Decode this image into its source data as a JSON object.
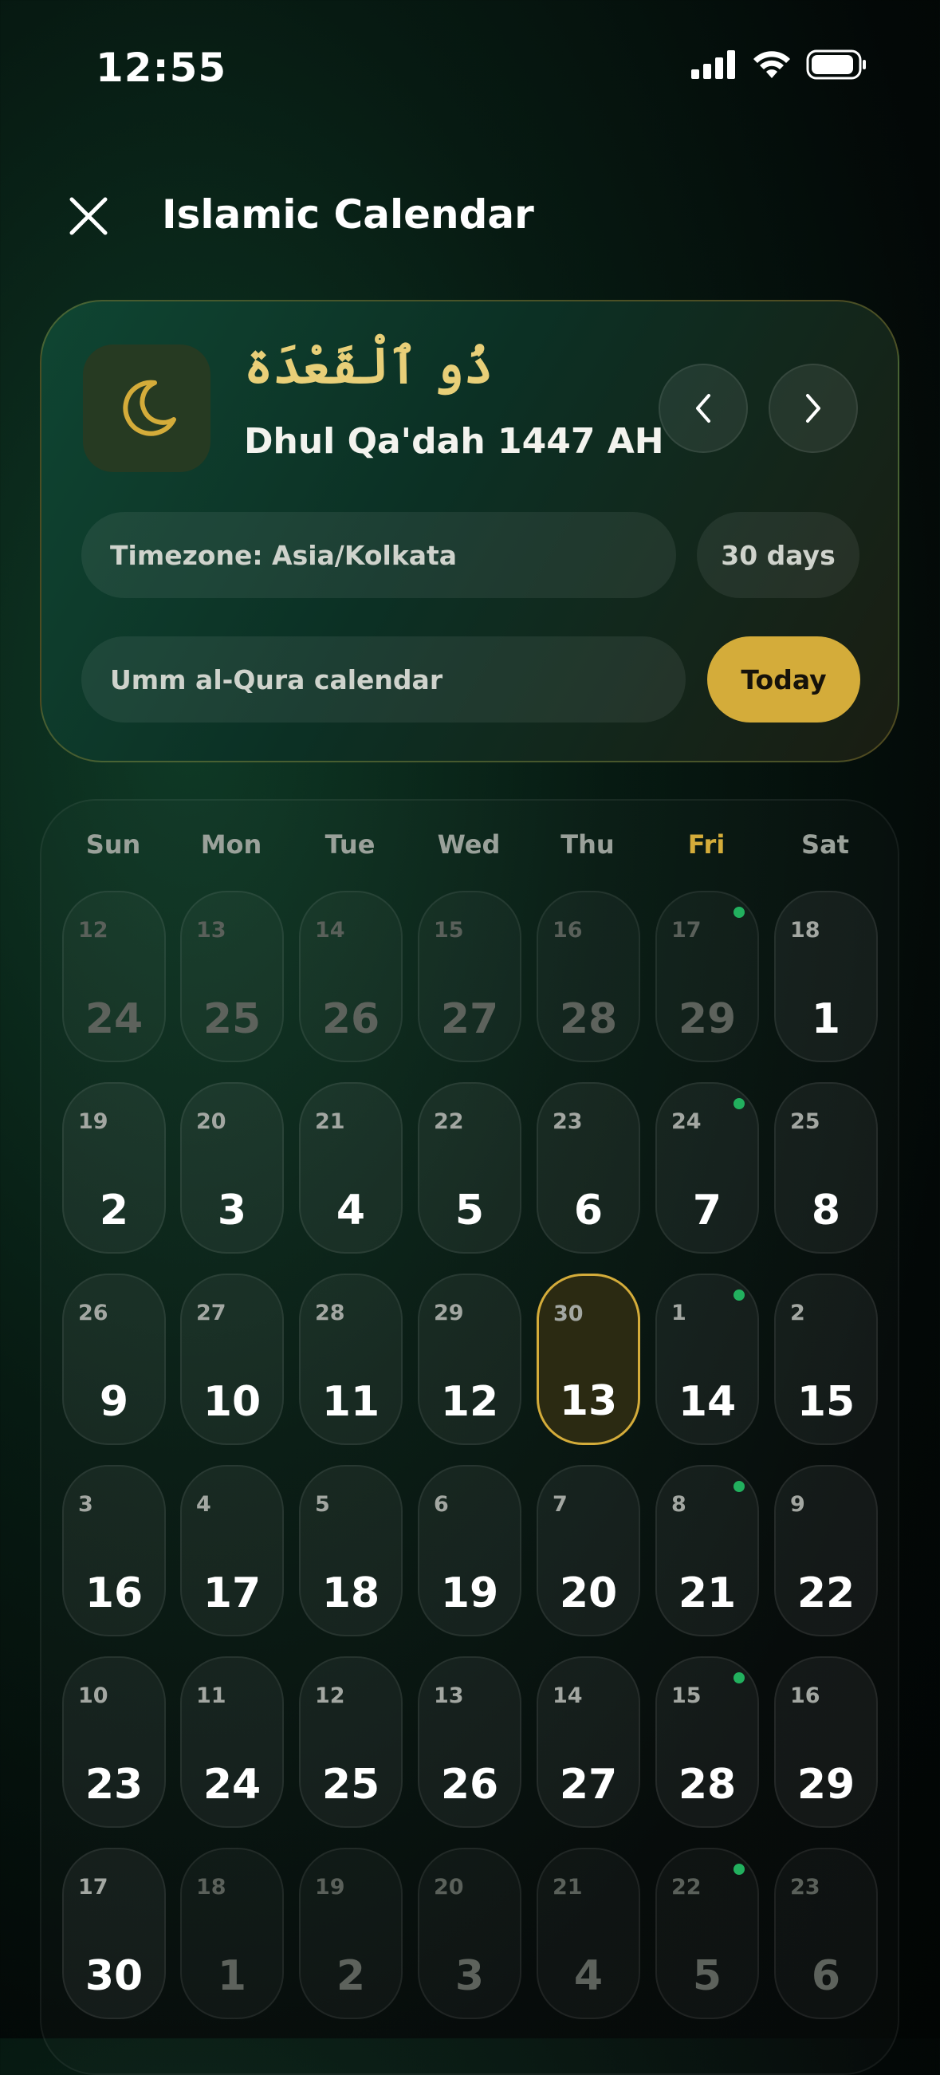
{
  "status_bar": {
    "time": "12:55"
  },
  "header": {
    "title": "Islamic Calendar"
  },
  "month_card": {
    "arabic_name": "ذُو ٱلْقَعْدَة",
    "english_name": "Dhul Qa'dah 1447 AH",
    "timezone": "Timezone: Asia/Kolkata",
    "days_count": "30 days",
    "calendar_type": "Umm al-Qura calendar",
    "today_label": "Today"
  },
  "weekdays": [
    "Sun",
    "Mon",
    "Tue",
    "Wed",
    "Thu",
    "Fri",
    "Sat"
  ],
  "highlight_weekday": "Fri",
  "colors": {
    "accent_gold": "#d4ac3a",
    "friday_dot": "#22b05e",
    "arabic_text": "#e8cf78"
  },
  "days": [
    {
      "g": "12",
      "h": "24",
      "muted": true
    },
    {
      "g": "13",
      "h": "25",
      "muted": true
    },
    {
      "g": "14",
      "h": "26",
      "muted": true
    },
    {
      "g": "15",
      "h": "27",
      "muted": true
    },
    {
      "g": "16",
      "h": "28",
      "muted": true
    },
    {
      "g": "17",
      "h": "29",
      "muted": true,
      "dot": true
    },
    {
      "g": "18",
      "h": "1"
    },
    {
      "g": "19",
      "h": "2"
    },
    {
      "g": "20",
      "h": "3"
    },
    {
      "g": "21",
      "h": "4"
    },
    {
      "g": "22",
      "h": "5"
    },
    {
      "g": "23",
      "h": "6"
    },
    {
      "g": "24",
      "h": "7",
      "dot": true
    },
    {
      "g": "25",
      "h": "8"
    },
    {
      "g": "26",
      "h": "9"
    },
    {
      "g": "27",
      "h": "10"
    },
    {
      "g": "28",
      "h": "11"
    },
    {
      "g": "29",
      "h": "12"
    },
    {
      "g": "30",
      "h": "13",
      "today": true
    },
    {
      "g": "1",
      "h": "14",
      "dot": true
    },
    {
      "g": "2",
      "h": "15"
    },
    {
      "g": "3",
      "h": "16"
    },
    {
      "g": "4",
      "h": "17"
    },
    {
      "g": "5",
      "h": "18"
    },
    {
      "g": "6",
      "h": "19"
    },
    {
      "g": "7",
      "h": "20"
    },
    {
      "g": "8",
      "h": "21",
      "dot": true
    },
    {
      "g": "9",
      "h": "22"
    },
    {
      "g": "10",
      "h": "23"
    },
    {
      "g": "11",
      "h": "24"
    },
    {
      "g": "12",
      "h": "25"
    },
    {
      "g": "13",
      "h": "26"
    },
    {
      "g": "14",
      "h": "27"
    },
    {
      "g": "15",
      "h": "28",
      "dot": true
    },
    {
      "g": "16",
      "h": "29"
    },
    {
      "g": "17",
      "h": "30"
    },
    {
      "g": "18",
      "h": "1",
      "muted": true
    },
    {
      "g": "19",
      "h": "2",
      "muted": true
    },
    {
      "g": "20",
      "h": "3",
      "muted": true
    },
    {
      "g": "21",
      "h": "4",
      "muted": true
    },
    {
      "g": "22",
      "h": "5",
      "muted": true,
      "dot": true
    },
    {
      "g": "23",
      "h": "6",
      "muted": true
    }
  ]
}
